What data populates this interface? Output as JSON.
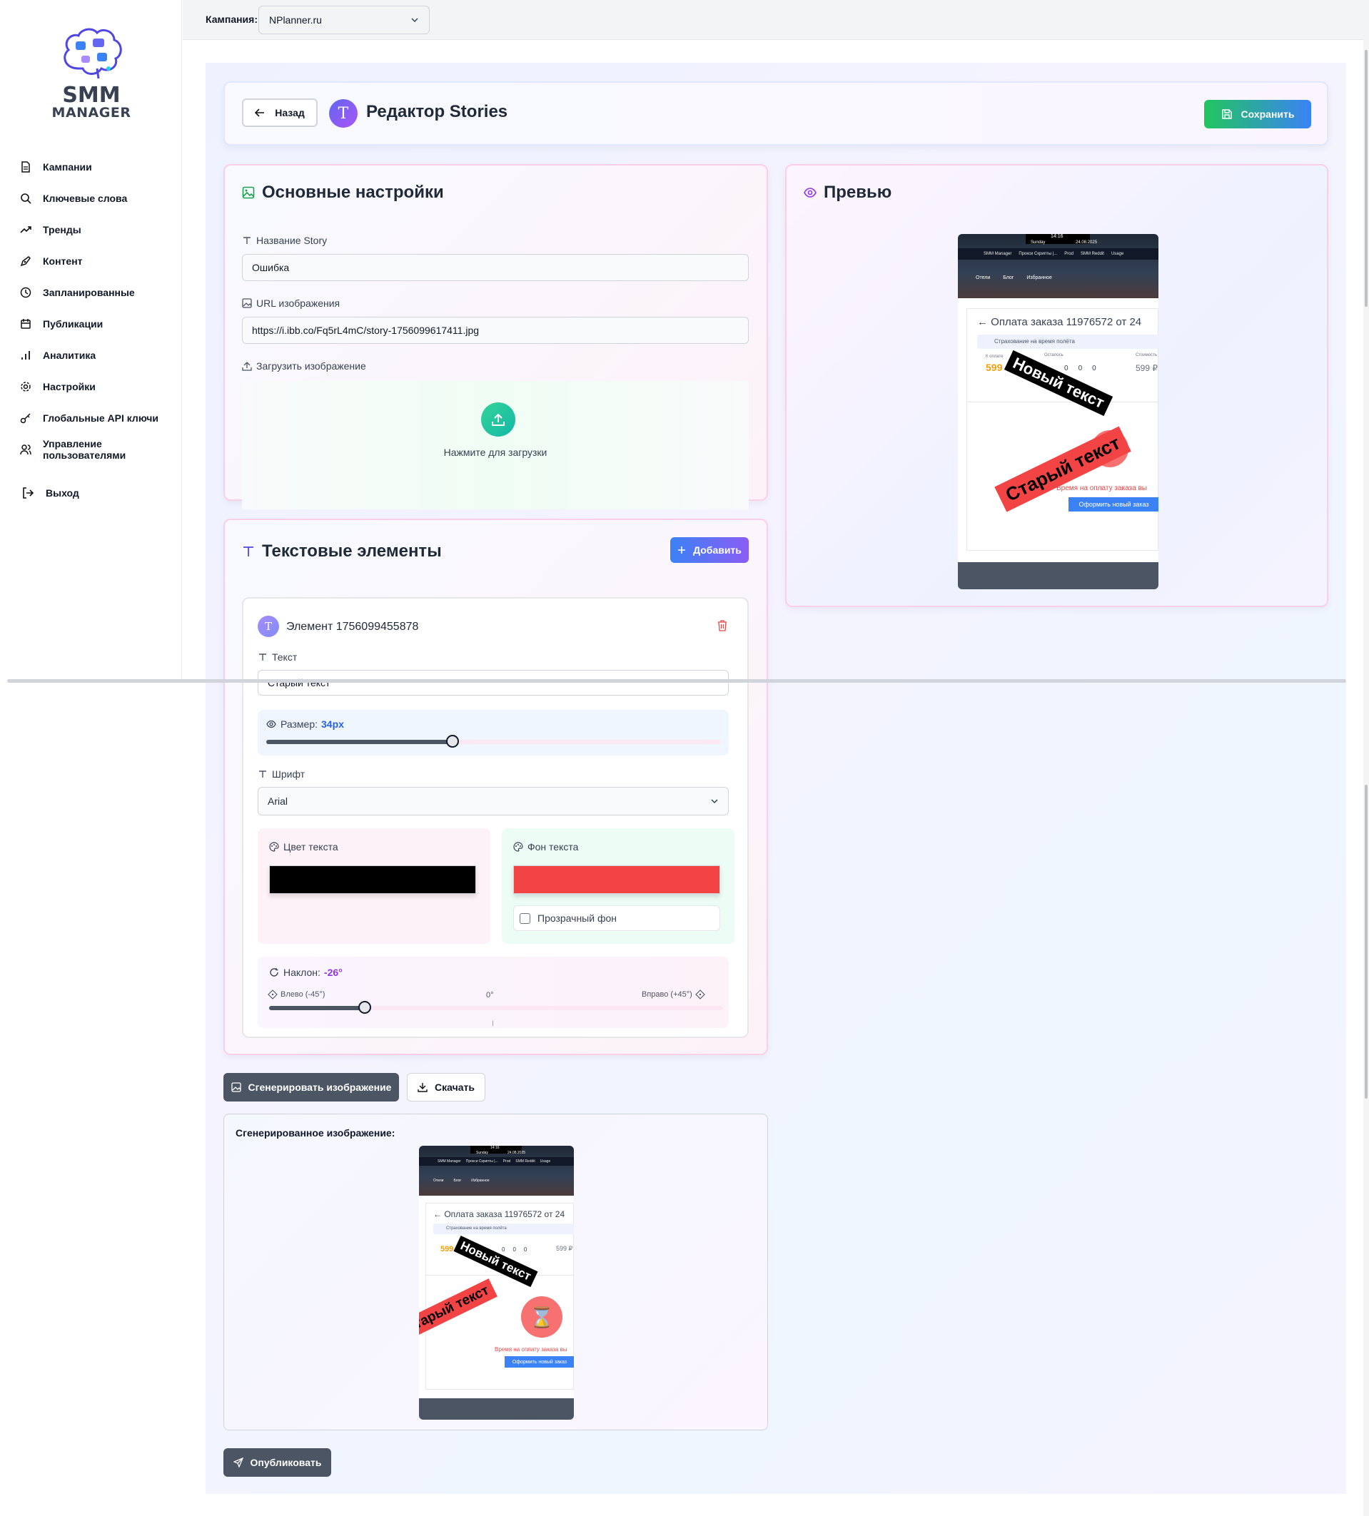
{
  "topbar": {
    "campaign_label": "Кампания:",
    "campaign_value": "NPlanner.ru"
  },
  "logo": {
    "line1": "SMM",
    "line2": "MANAGER"
  },
  "sidebar": {
    "items": [
      {
        "label": "Кампании",
        "icon": "file-icon"
      },
      {
        "label": "Ключевые слова",
        "icon": "search-icon"
      },
      {
        "label": "Тренды",
        "icon": "trending-icon"
      },
      {
        "label": "Контент",
        "icon": "pen-icon"
      },
      {
        "label": "Запланированные",
        "icon": "clock-icon"
      },
      {
        "label": "Публикации",
        "icon": "calendar-icon"
      },
      {
        "label": "Аналитика",
        "icon": "bar-chart-icon"
      },
      {
        "label": "Настройки",
        "icon": "gear-icon"
      },
      {
        "label": "Глобальные API ключи",
        "icon": "key-icon"
      },
      {
        "label": "Управление пользователями",
        "icon": "users-icon"
      }
    ],
    "logout": "Выход"
  },
  "header": {
    "back": "Назад",
    "avatar_letter": "T",
    "title": "Редактор Stories",
    "save": "Сохранить"
  },
  "basic": {
    "title": "Основные настройки",
    "name_label": "Название Story",
    "name_value": "Ошибка",
    "url_label": "URL изображения",
    "url_value": "https://i.ibb.co/Fq5rL4mC/story-1756099617411.jpg",
    "upload_label": "Загрузить изображение",
    "upload_hint": "Нажмите для загрузки"
  },
  "preview": {
    "title": "Превью"
  },
  "text_elements": {
    "title": "Текстовые элементы",
    "add": "Добавить",
    "element": {
      "avatar_letter": "T",
      "title": "Элемент 1756099455878",
      "text_label": "Текст",
      "text_value": "Старый текст",
      "size_label": "Размер:",
      "size_value": "34px",
      "size_fraction": 0.41,
      "font_label": "Шрифт",
      "font_value": "Arial",
      "color_label": "Цвет текста",
      "color_value": "#000000",
      "bg_label": "Фон текста",
      "bg_value": "#f24444",
      "transparent_label": "Прозрачный фон",
      "tilt_label": "Наклон:",
      "tilt_value": "-26°",
      "tilt_left": "Влево (-45°)",
      "tilt_center": "0°",
      "tilt_right": "Вправо (+45°)",
      "tilt_fraction": 0.21
    }
  },
  "actions": {
    "generate": "Сгенерировать изображение",
    "download": "Скачать",
    "publish": "Опубликовать"
  },
  "generated": {
    "label": "Сгенерированное изображение:"
  },
  "story_image": {
    "status_time": "14:16",
    "status_day": "Sunday",
    "status_date": "24.08.2025",
    "tabs": [
      "SMM Manager",
      "Прокси Скрипты |...",
      "Prod",
      "SMM Reddit",
      "Usage"
    ],
    "nav": [
      "Отели",
      "Блог",
      "Избранное"
    ],
    "order_title": "Оплата заказа 11976572 от 24",
    "insurance": "Страхование на время полёта",
    "pay_label": "К оплате",
    "pay_value": "599",
    "left_label": "Осталось",
    "left_values": [
      "0",
      "0",
      "0"
    ],
    "cost_label": "Стоимость",
    "cost_value": "599 ₽",
    "sticker_new": "Новый текст",
    "sticker_old": "Старый текст",
    "timeout_text": "Время на оплату заказа вы",
    "new_order_button": "Оформить новый заказ"
  }
}
